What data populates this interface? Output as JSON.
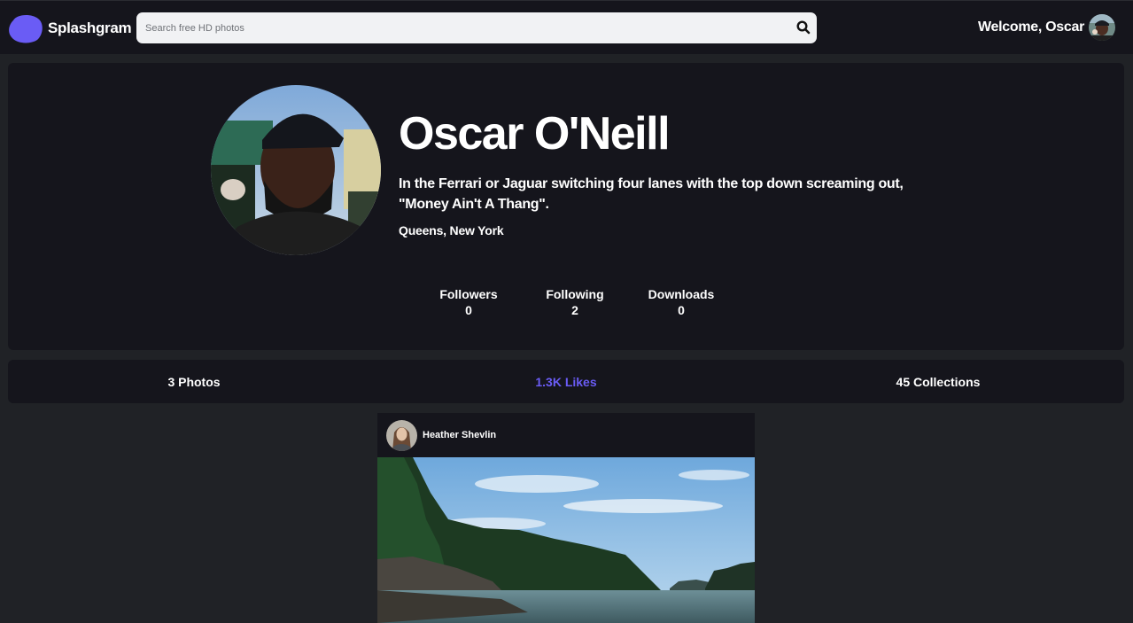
{
  "app": {
    "name": "Splashgram",
    "brand_color": "#6a5cf5"
  },
  "search": {
    "placeholder": "Search free HD photos",
    "value": "",
    "icon": "search-icon"
  },
  "header": {
    "welcome_text": "Welcome, Oscar"
  },
  "profile": {
    "name": "Oscar O'Neill",
    "bio": "In the Ferrari or Jaguar switching four lanes with the top down screaming out, \"Money Ain't A Thang\".",
    "location": "Queens, New York",
    "stats": [
      {
        "label": "Followers",
        "value": "0"
      },
      {
        "label": "Following",
        "value": "2"
      },
      {
        "label": "Downloads",
        "value": "0"
      }
    ]
  },
  "tabs": [
    {
      "label": "3 Photos",
      "active": false
    },
    {
      "label": "1.3K Likes",
      "active": true
    },
    {
      "label": "45 Collections",
      "active": false
    }
  ],
  "feed": {
    "posts": [
      {
        "author": "Heather Shevlin"
      }
    ]
  }
}
